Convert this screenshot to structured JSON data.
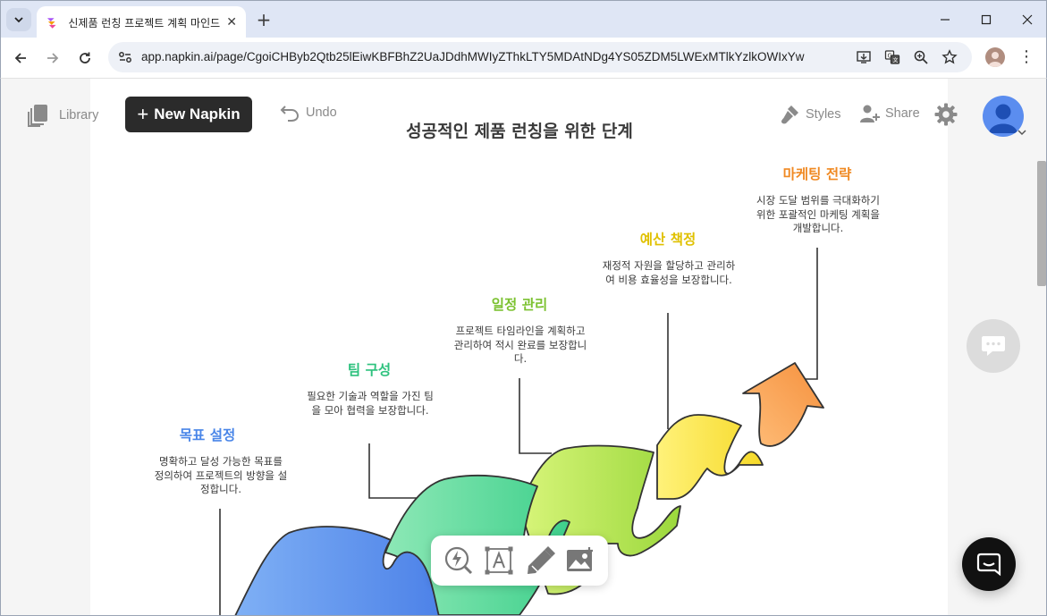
{
  "browser": {
    "tab_title": "신제품 런칭 프로젝트 계획 마인드맵",
    "url": "app.napkin.ai/page/CgoiCHByb2Qtb25lEiwKBFBhZ2UaJDdhMWIyZThkLTY5MDAtNDg4YS05ZDM5LWExMTlkYzlkOWIxYw"
  },
  "app_toolbar": {
    "library_label": "Library",
    "new_napkin_label": "New Napkin",
    "undo_label": "Undo",
    "styles_label": "Styles",
    "share_label": "Share"
  },
  "diagram": {
    "title": "성공적인 제품 런칭을 위한 단계",
    "steps": [
      {
        "title": "목표 설정",
        "desc": "명확하고 달성 가능한 목표를 정의하여 프로젝트의 방향을 설정합니다.",
        "color": "#4a86e8"
      },
      {
        "title": "팀 구성",
        "desc": "필요한 기술과 역할을 가진 팀을 모아 협력을 보장합니다.",
        "color": "#2ec27e"
      },
      {
        "title": "일정 관리",
        "desc": "프로젝트 타임라인을 계획하고 관리하여 적시 완료를 보장합니다.",
        "color": "#7cc231"
      },
      {
        "title": "예산 책정",
        "desc": "재정적 자원을 할당하고 관리하여 비용 효율성을 보장합니다.",
        "color": "#e0c100"
      },
      {
        "title": "마케팅 전략",
        "desc": "시장 도달 범위를 극대화하기 위한 포괄적인 마케팅 계획을 개발합니다.",
        "color": "#f08a24"
      }
    ]
  },
  "icons": {
    "tab_menu": "chevron-down-icon",
    "favicon": "napkin-favicon-icon",
    "settings": "gear-icon",
    "chat": "chat-bubble-icon",
    "intercom": "intercom-icon"
  }
}
